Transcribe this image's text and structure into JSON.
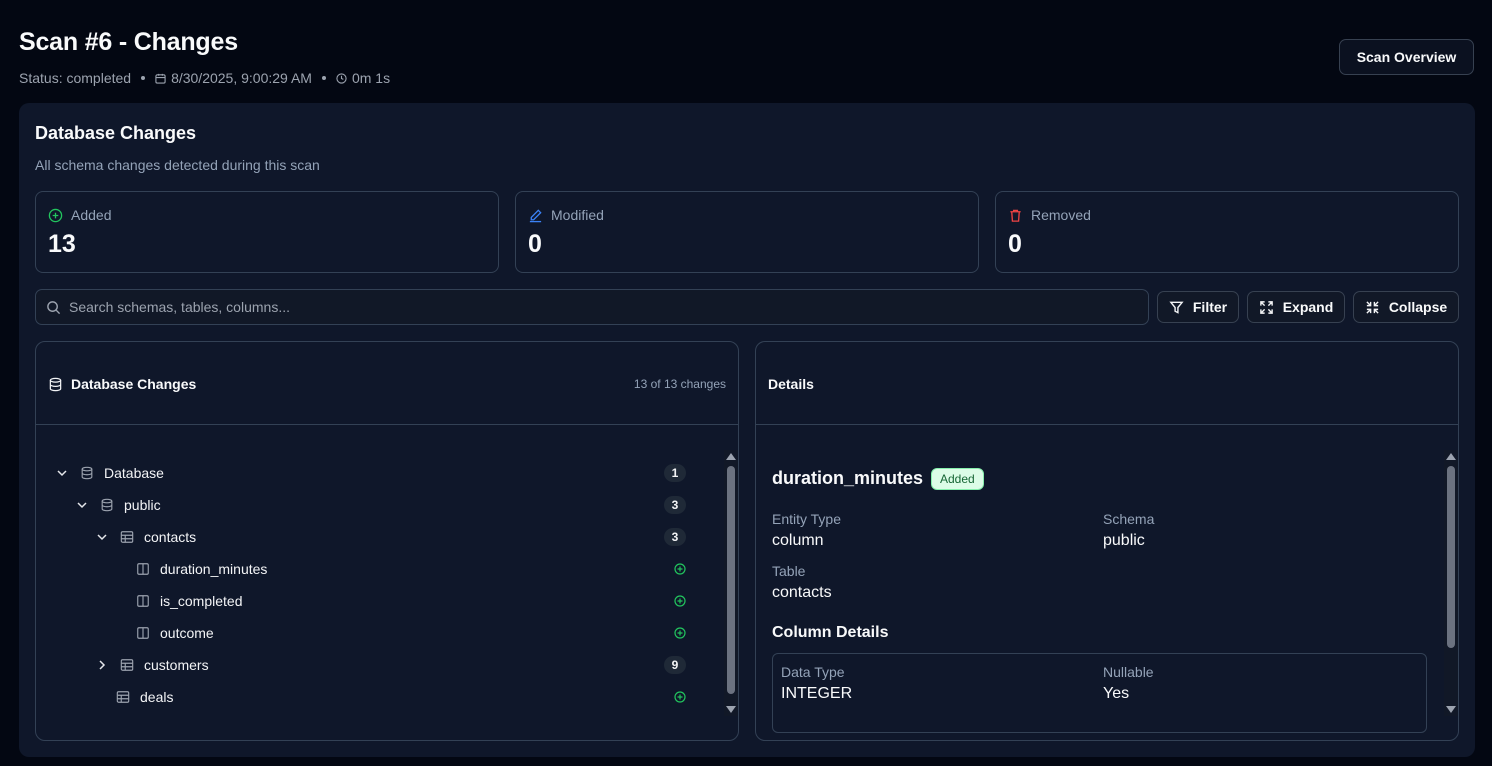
{
  "header": {
    "title": "Scan #6 - Changes",
    "status": "Status: completed",
    "date": "8/30/2025, 9:00:29 AM",
    "duration": "0m 1s",
    "overview_button": "Scan Overview"
  },
  "card": {
    "title": "Database Changes",
    "subtitle": "All schema changes detected during this scan"
  },
  "stats": {
    "added": {
      "label": "Added",
      "value": "13",
      "color": "#22c55e"
    },
    "modified": {
      "label": "Modified",
      "value": "0",
      "color": "#3b82f6"
    },
    "removed": {
      "label": "Removed",
      "value": "0",
      "color": "#ef4444"
    }
  },
  "search": {
    "placeholder": "Search schemas, tables, columns..."
  },
  "toolbar": {
    "filter": "Filter",
    "expand": "Expand",
    "collapse": "Collapse"
  },
  "tree_panel": {
    "title": "Database Changes",
    "count": "13 of 13 changes",
    "rows": [
      {
        "label": "Database",
        "type": "database",
        "expanded": true,
        "badge": "1"
      },
      {
        "label": "public",
        "type": "schema",
        "expanded": true,
        "badge": "3"
      },
      {
        "label": "contacts",
        "type": "table",
        "expanded": true,
        "badge": "3"
      },
      {
        "label": "duration_minutes",
        "type": "column",
        "status": "added"
      },
      {
        "label": "is_completed",
        "type": "column",
        "status": "added"
      },
      {
        "label": "outcome",
        "type": "column",
        "status": "added"
      },
      {
        "label": "customers",
        "type": "table",
        "expanded": false,
        "badge": "9"
      },
      {
        "label": "deals",
        "type": "table",
        "status": "added"
      }
    ]
  },
  "details_panel": {
    "title": "Details",
    "entity_name": "duration_minutes",
    "status_badge": "Added",
    "entity_type_label": "Entity Type",
    "entity_type_value": "column",
    "schema_label": "Schema",
    "schema_value": "public",
    "table_label": "Table",
    "table_value": "contacts",
    "column_details_title": "Column Details",
    "data_type_label": "Data Type",
    "data_type_value": "INTEGER",
    "nullable_label": "Nullable",
    "nullable_value": "Yes"
  }
}
